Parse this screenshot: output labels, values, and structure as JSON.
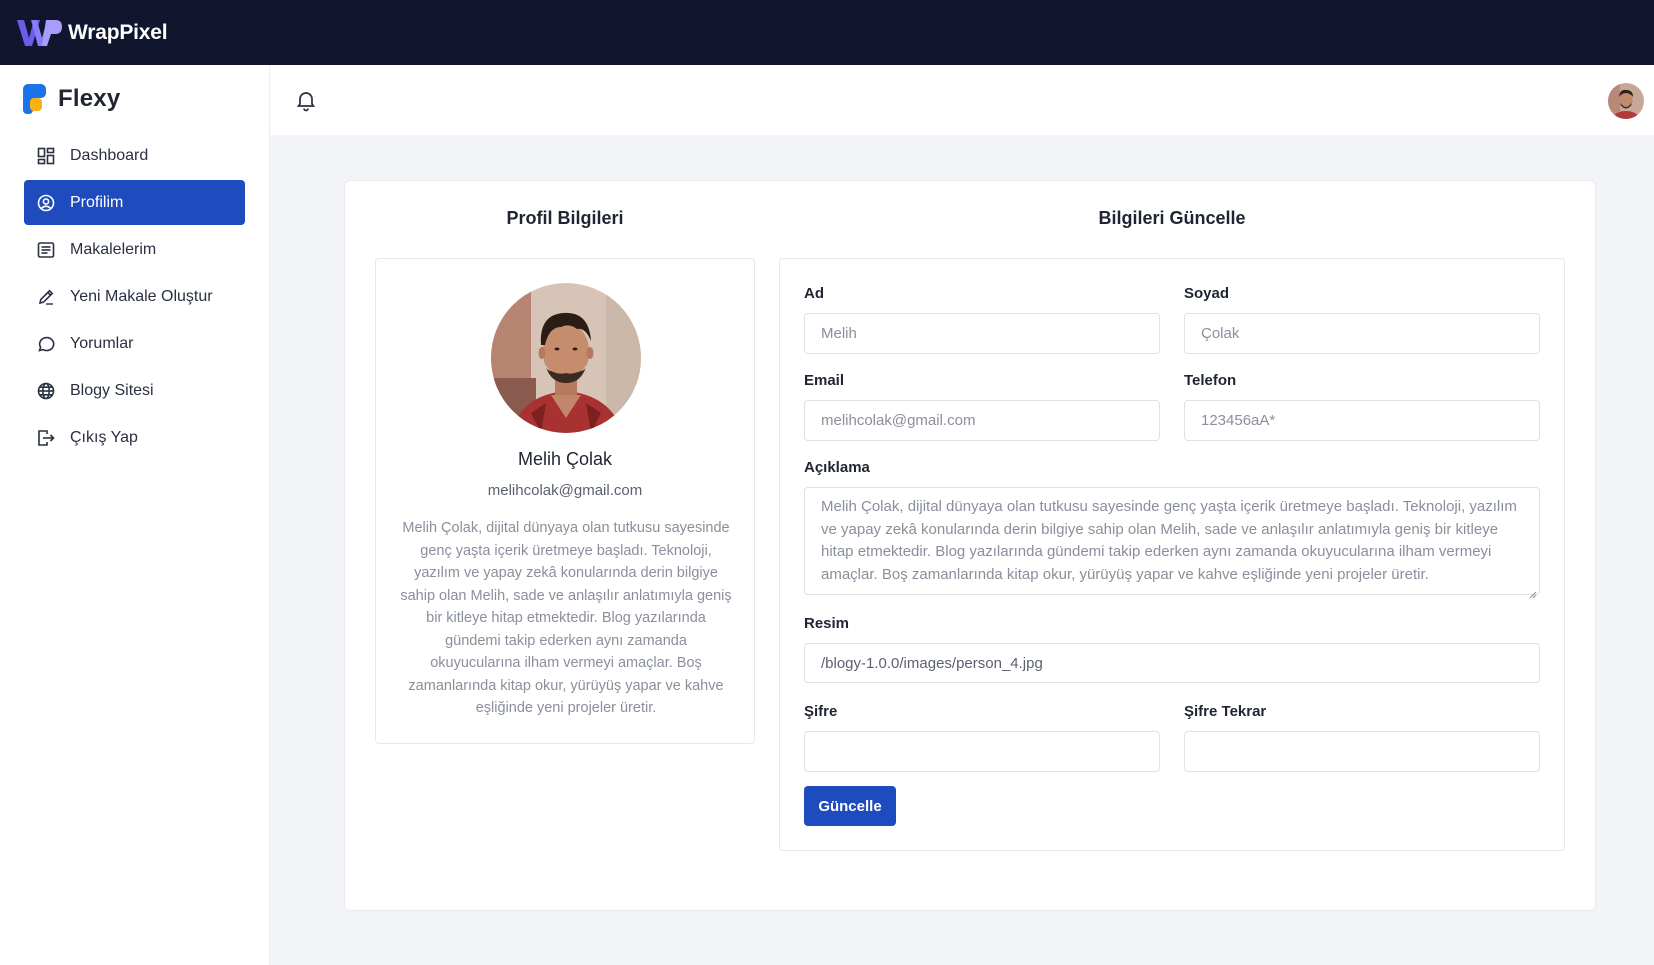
{
  "topbar": {
    "logo_text": "WrapPixel"
  },
  "brand": {
    "name": "Flexy"
  },
  "sidebar": {
    "items": [
      {
        "label": "Dashboard",
        "icon": "dashboard-icon",
        "active": false
      },
      {
        "label": "Profilim",
        "icon": "user-circle-icon",
        "active": true
      },
      {
        "label": "Makalelerim",
        "icon": "article-icon",
        "active": false
      },
      {
        "label": "Yeni Makale Oluştur",
        "icon": "pencil-icon",
        "active": false
      },
      {
        "label": "Yorumlar",
        "icon": "comment-icon",
        "active": false
      },
      {
        "label": "Blogy Sitesi",
        "icon": "globe-icon",
        "active": false
      },
      {
        "label": "Çıkış Yap",
        "icon": "logout-icon",
        "active": false
      }
    ]
  },
  "header": {
    "bell_icon": "bell-icon",
    "avatar_icon": "user-avatar"
  },
  "profile": {
    "title": "Profil Bilgileri",
    "name": "Melih Çolak",
    "email": "melihcolak@gmail.com",
    "bio": "Melih Çolak, dijital dünyaya olan tutkusu sayesinde genç yaşta içerik üretmeye başladı. Teknoloji, yazılım ve yapay zekâ konularında derin bilgiye sahip olan Melih, sade ve anlaşılır anlatımıyla geniş bir kitleye hitap etmektedir. Blog yazılarında gündemi takip ederken aynı zamanda okuyucularına ilham vermeyi amaçlar. Boş zamanlarında kitap okur, yürüyüş yapar ve kahve eşliğinde yeni projeler üretir."
  },
  "form": {
    "title": "Bilgileri Güncelle",
    "ad_label": "Ad",
    "ad_value": "Melih",
    "soyad_label": "Soyad",
    "soyad_value": "Çolak",
    "email_label": "Email",
    "email_value": "melihcolak@gmail.com",
    "telefon_label": "Telefon",
    "telefon_value": "123456aA*",
    "aciklama_label": "Açıklama",
    "aciklama_value": "Melih Çolak, dijital dünyaya olan tutkusu sayesinde genç yaşta içerik üretmeye başladı. Teknoloji, yazılım ve yapay zekâ konularında derin bilgiye sahip olan Melih, sade ve anlaşılır anlatımıyla geniş bir kitleye hitap etmektedir. Blog yazılarında gündemi takip ederken aynı zamanda okuyucularına ilham vermeyi amaçlar. Boş zamanlarında kitap okur, yürüyüş yapar ve kahve eşliğinde yeni projeler üretir.",
    "resim_label": "Resim",
    "resim_value": "/blogy-1.0.0/images/person_4.jpg",
    "sifre_label": "Şifre",
    "sifre_value": "",
    "sifre_tekrar_label": "Şifre Tekrar",
    "sifre_tekrar_value": "",
    "submit_label": "Güncelle"
  },
  "colors": {
    "topbar": "#11162e",
    "accent": "#1e4bbd",
    "background": "#f3f4f8"
  }
}
